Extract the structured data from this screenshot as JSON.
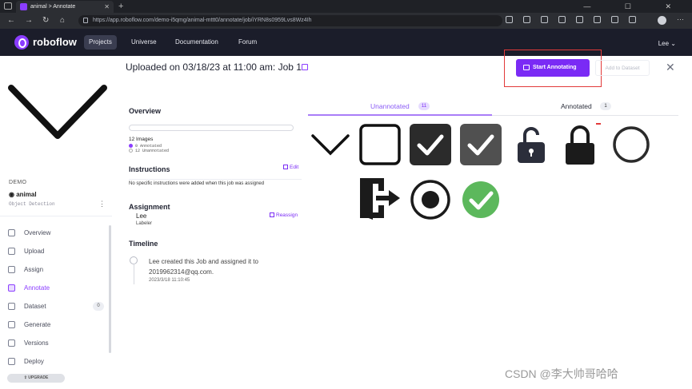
{
  "browser": {
    "tab_title": "animal > Annotate",
    "new_tab": "+",
    "url": "https://app.roboflow.com/demo-i5qmg/animal-mttt0/annotate/job/iYRN8s0959Lvs8Wz4Ih",
    "window_controls": "— ☐ ✕"
  },
  "nav": {
    "logo": "roboflow",
    "items": [
      "Projects",
      "Universe",
      "Documentation",
      "Forum"
    ],
    "active": "Projects",
    "user": "Lee ⌄"
  },
  "sidebar": {
    "workspace": "DEMO",
    "project_name": "animal",
    "project_type": "Object Detection",
    "kebab": "⋮",
    "items": [
      {
        "label": "Overview",
        "icon": "overview-icon"
      },
      {
        "label": "Upload",
        "icon": "upload-icon"
      },
      {
        "label": "Assign",
        "icon": "assign-icon"
      },
      {
        "label": "Annotate",
        "icon": "annotate-icon"
      },
      {
        "label": "Dataset",
        "icon": "dataset-icon",
        "badge": "0"
      },
      {
        "label": "Generate",
        "icon": "generate-icon"
      },
      {
        "label": "Versions",
        "icon": "versions-icon"
      },
      {
        "label": "Deploy",
        "icon": "deploy-icon"
      }
    ],
    "active": "Annotate",
    "upgrade": "UPGRADE"
  },
  "header": {
    "title": "Uploaded on 03/18/23 at 11:00 am: Job 1",
    "start_button": "Start Annotating",
    "add_dataset": "Add to Dataset",
    "close": "✕"
  },
  "overview": {
    "heading": "Overview",
    "images": "12 Images",
    "annotated": "0 Annotated",
    "unannotated": "12 Unannotated",
    "annotated_fraction": 0
  },
  "instructions": {
    "heading": "Instructions",
    "edit": "Edit",
    "text": "No specific instructions were added when this job was assigned"
  },
  "assignment": {
    "heading": "Assignment",
    "name": "Lee",
    "role": "Labeler",
    "reassign": "Reassign"
  },
  "timeline": {
    "heading": "Timeline",
    "text": "Lee created this Job and assigned it to 2019962314@qq.com.",
    "time": "2023/3/18 11:10:45"
  },
  "tabs": {
    "unannotated_label": "Unannotated",
    "unannotated_count": "11",
    "annotated_label": "Annotated",
    "annotated_count": "1"
  },
  "thumbnails": [
    "chevron-down-icon",
    "empty-checkbox-icon",
    "checked-box-dark-icon",
    "checked-box-gray-icon",
    "unlocked-padlock-icon",
    "locked-padlock-icon",
    "empty-circle-icon",
    "exit-door-icon",
    "radio-selected-icon",
    "green-check-circle-icon"
  ],
  "colors": {
    "accent": "#7a2bf5",
    "nav_bg": "#1b1d2a",
    "highlight_box": "#e23a3a",
    "check_green": "#5cb85c"
  },
  "watermark": "CSDN @李大帅哥哈哈"
}
